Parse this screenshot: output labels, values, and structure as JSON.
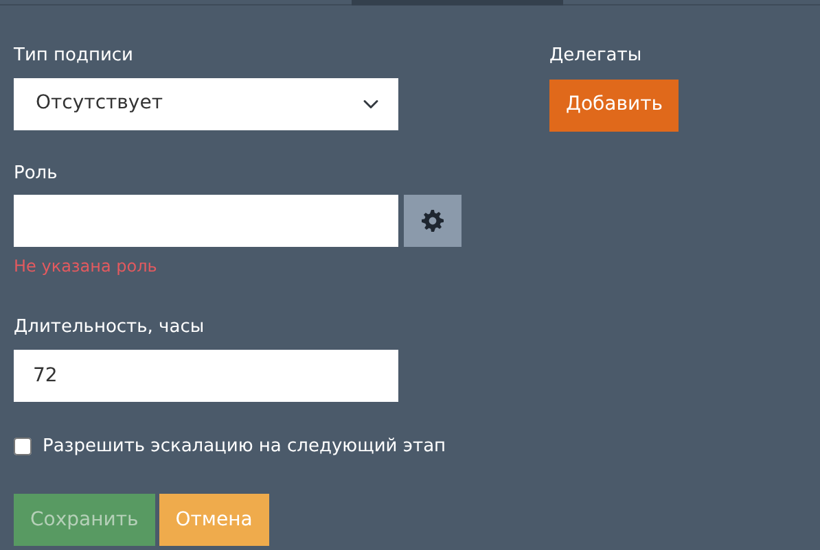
{
  "signature_type": {
    "label": "Тип подписи",
    "value": "Отсутствует"
  },
  "delegates": {
    "label": "Делегаты",
    "add_button": "Добавить"
  },
  "role": {
    "label": "Роль",
    "error": "Не указана роль"
  },
  "duration": {
    "label": "Длительность, часы",
    "value": "72"
  },
  "escalation": {
    "label": "Разрешить эскалацию на следующий этап",
    "checked": false
  },
  "buttons": [
    {
      "kind": "save",
      "label": "Сохранить",
      "disabled": true
    },
    {
      "kind": "cancel",
      "label": "Отмена",
      "disabled": false
    }
  ]
}
